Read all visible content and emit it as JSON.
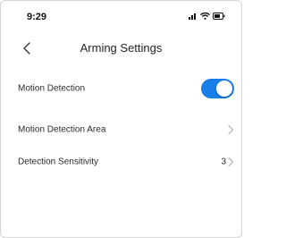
{
  "status_bar": {
    "time": "9:29",
    "icons": [
      "signal-icon",
      "wifi-icon",
      "battery-icon"
    ]
  },
  "header": {
    "title": "Arming Settings",
    "back_icon": "chevron-left-icon"
  },
  "settings": {
    "motion_detection": {
      "label": "Motion Detection",
      "enabled": true
    },
    "motion_detection_area": {
      "label": "Motion Detection Area"
    },
    "detection_sensitivity": {
      "label": "Detection Sensitivity",
      "value": "3"
    }
  },
  "colors": {
    "accent": "#1a7ee8",
    "chevron": "#b0b0b0",
    "text": "#2a2a2a"
  }
}
